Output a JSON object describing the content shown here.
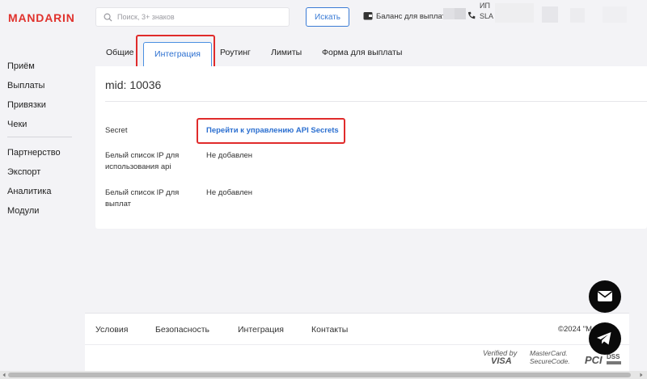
{
  "header": {
    "logo": "MANDARIN",
    "search": {
      "placeholder": "Поиск, 3+ знаков",
      "value": "",
      "button": "Искать"
    },
    "balance_label": "Баланс для выплат:",
    "user_line1": "ИП",
    "user_line2": "SLA"
  },
  "sidebar": {
    "items": [
      {
        "label": "Приём"
      },
      {
        "label": "Выплаты"
      },
      {
        "label": "Привязки"
      },
      {
        "label": "Чеки"
      },
      {
        "label": "Партнерство"
      },
      {
        "label": "Экспорт"
      },
      {
        "label": "Аналитика"
      },
      {
        "label": "Модули"
      }
    ]
  },
  "tabs": [
    {
      "label": "Общие",
      "active": false
    },
    {
      "label": "Интеграция",
      "active": true
    },
    {
      "label": "Роутинг",
      "active": false
    },
    {
      "label": "Лимиты",
      "active": false
    },
    {
      "label": "Форма для выплаты",
      "active": false
    }
  ],
  "content": {
    "title": "mid: 10036",
    "rows": [
      {
        "label": "Secret",
        "value": "Перейти к управлению API Secrets"
      },
      {
        "label": "Белый список IP для использования api",
        "value": "Не добавлен"
      },
      {
        "label": "Белый список IP для выплат",
        "value": "Не добавлен"
      }
    ]
  },
  "footer": {
    "links": [
      "Условия",
      "Безопасность",
      "Интеграция",
      "Контакты"
    ],
    "copyright": "©2024 \"M...\"",
    "badges": {
      "visa_top": "Verified by",
      "visa_bottom": "VISA",
      "mc_top": "MasterCard.",
      "mc_bottom": "SecureCode.",
      "pci_letters": "PCI",
      "dss_letters": "DSS"
    }
  },
  "colors": {
    "brand": "#e0322d",
    "link": "#2b6fd0",
    "highlight": "#e02b2b"
  }
}
